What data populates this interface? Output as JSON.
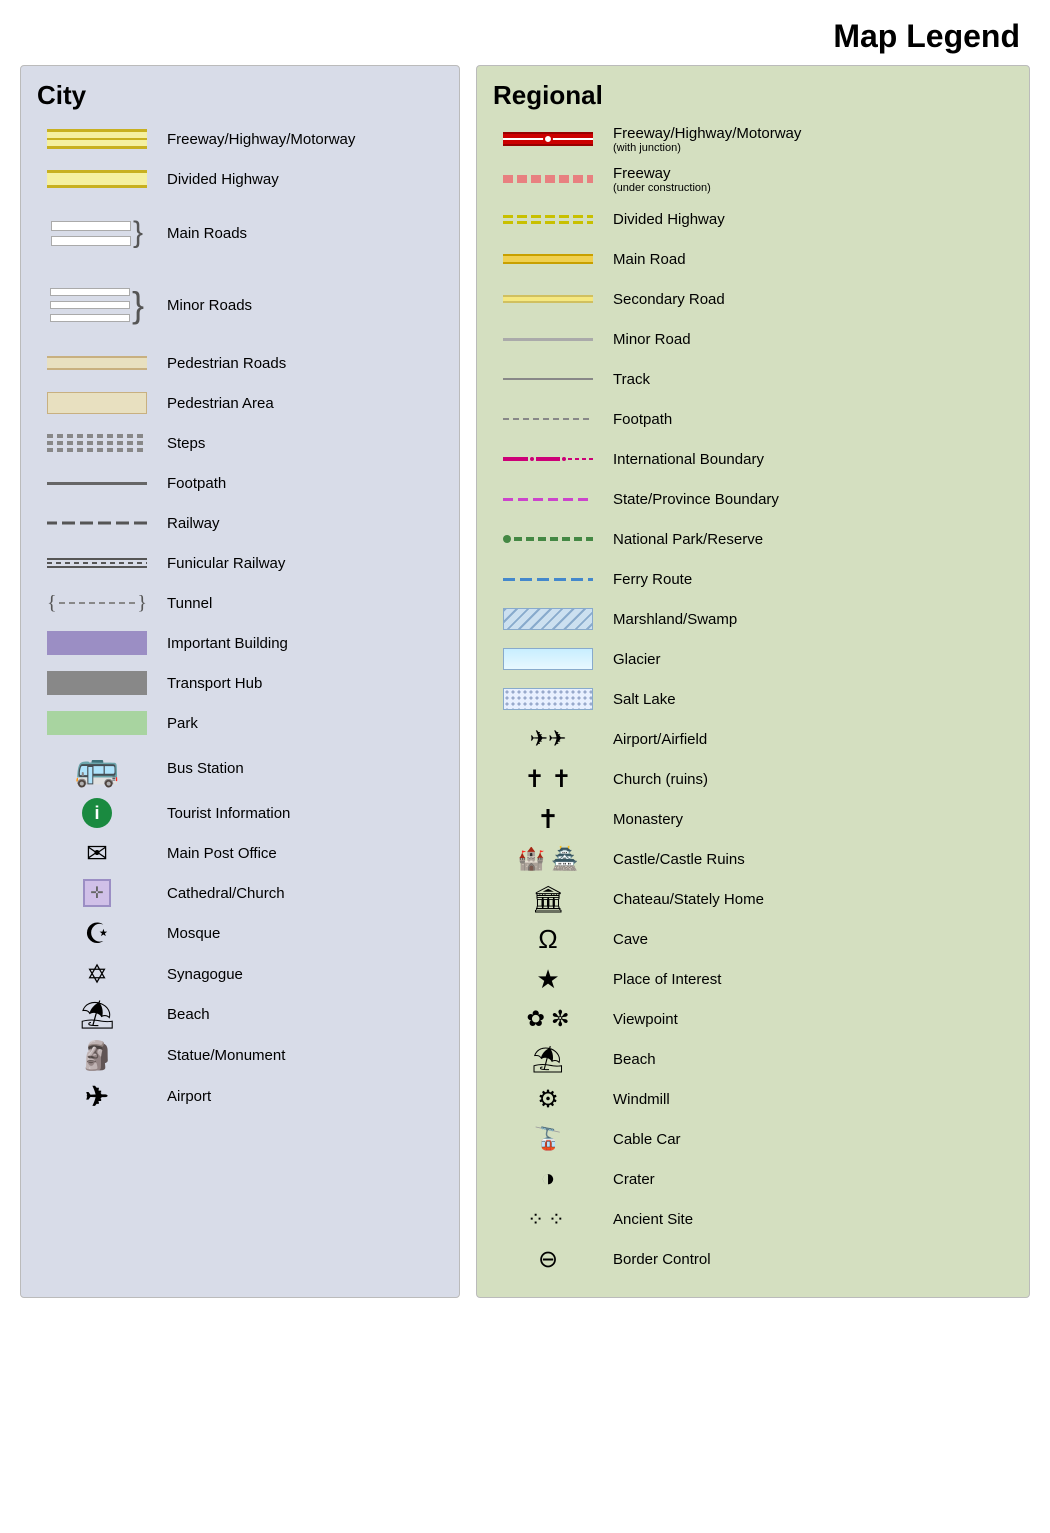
{
  "title": "Map Legend",
  "city": {
    "title": "City",
    "items": [
      {
        "id": "freeway",
        "label": "Freeway/Highway/Motorway"
      },
      {
        "id": "divided-highway",
        "label": "Divided Highway"
      },
      {
        "id": "main-roads",
        "label": "Main Roads"
      },
      {
        "id": "minor-roads",
        "label": "Minor Roads"
      },
      {
        "id": "pedestrian-roads",
        "label": "Pedestrian Roads"
      },
      {
        "id": "pedestrian-area",
        "label": "Pedestrian Area"
      },
      {
        "id": "steps",
        "label": "Steps"
      },
      {
        "id": "footpath",
        "label": "Footpath"
      },
      {
        "id": "railway",
        "label": "Railway"
      },
      {
        "id": "funicular-railway",
        "label": "Funicular Railway"
      },
      {
        "id": "tunnel",
        "label": "Tunnel"
      },
      {
        "id": "important-building",
        "label": "Important Building"
      },
      {
        "id": "transport-hub",
        "label": "Transport Hub"
      },
      {
        "id": "park",
        "label": "Park"
      },
      {
        "id": "bus-station",
        "label": "Bus Station"
      },
      {
        "id": "tourist-information",
        "label": "Tourist Information"
      },
      {
        "id": "main-post-office",
        "label": "Main Post Office"
      },
      {
        "id": "cathedral-church",
        "label": "Cathedral/Church"
      },
      {
        "id": "mosque",
        "label": "Mosque"
      },
      {
        "id": "synagogue",
        "label": "Synagogue"
      },
      {
        "id": "beach",
        "label": "Beach"
      },
      {
        "id": "statue-monument",
        "label": "Statue/Monument"
      },
      {
        "id": "airport",
        "label": "Airport"
      }
    ]
  },
  "regional": {
    "title": "Regional",
    "items": [
      {
        "id": "reg-freeway",
        "label": "Freeway/Highway/Motorway",
        "sublabel": "(with junction)"
      },
      {
        "id": "reg-freeway-construction",
        "label": "Freeway",
        "sublabel": "(under construction)"
      },
      {
        "id": "reg-divided-highway",
        "label": "Divided Highway"
      },
      {
        "id": "reg-main-road",
        "label": "Main Road"
      },
      {
        "id": "reg-secondary-road",
        "label": "Secondary Road"
      },
      {
        "id": "reg-minor-road",
        "label": "Minor Road"
      },
      {
        "id": "reg-track",
        "label": "Track"
      },
      {
        "id": "reg-footpath",
        "label": "Footpath"
      },
      {
        "id": "reg-intl-boundary",
        "label": "International Boundary"
      },
      {
        "id": "reg-state-boundary",
        "label": "State/Province Boundary"
      },
      {
        "id": "reg-national-park",
        "label": "National Park/Reserve"
      },
      {
        "id": "reg-ferry",
        "label": "Ferry Route"
      },
      {
        "id": "reg-marshland",
        "label": "Marshland/Swamp"
      },
      {
        "id": "reg-glacier",
        "label": "Glacier"
      },
      {
        "id": "reg-salt-lake",
        "label": "Salt Lake"
      },
      {
        "id": "reg-airport",
        "label": "Airport/Airfield"
      },
      {
        "id": "reg-church",
        "label": "Church (ruins)"
      },
      {
        "id": "reg-monastery",
        "label": "Monastery"
      },
      {
        "id": "reg-castle",
        "label": "Castle/Castle Ruins"
      },
      {
        "id": "reg-chateau",
        "label": "Chateau/Stately Home"
      },
      {
        "id": "reg-cave",
        "label": "Cave"
      },
      {
        "id": "reg-place-interest",
        "label": "Place of Interest"
      },
      {
        "id": "reg-viewpoint",
        "label": "Viewpoint"
      },
      {
        "id": "reg-beach",
        "label": "Beach"
      },
      {
        "id": "reg-windmill",
        "label": "Windmill"
      },
      {
        "id": "reg-cable-car",
        "label": "Cable Car"
      },
      {
        "id": "reg-crater",
        "label": "Crater"
      },
      {
        "id": "reg-ancient-site",
        "label": "Ancient Site"
      },
      {
        "id": "reg-border-control",
        "label": "Border Control"
      }
    ]
  }
}
